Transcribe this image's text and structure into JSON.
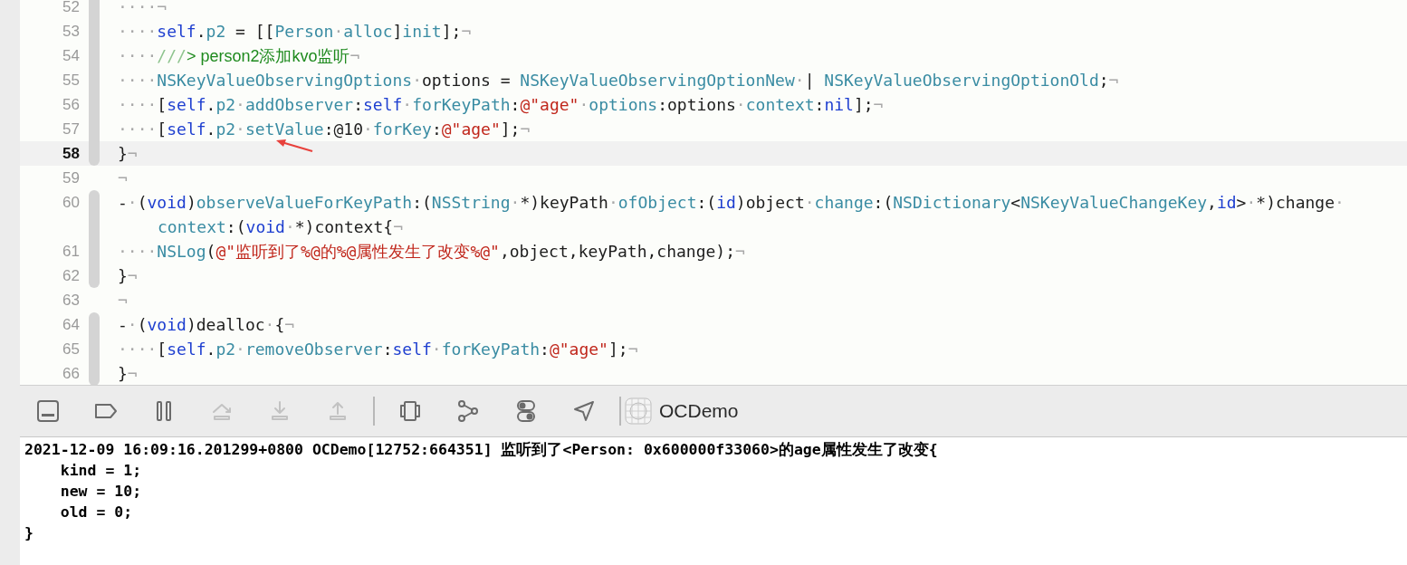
{
  "editor": {
    "lines": [
      {
        "number": "52",
        "current": false,
        "fold_bar": true,
        "tokens": [
          {
            "kind": "ws",
            "text": "····¬"
          }
        ]
      },
      {
        "number": "53",
        "current": false,
        "fold_bar": true,
        "tokens": [
          {
            "kind": "ws",
            "text": "····"
          },
          {
            "kind": "keyword",
            "text": "self"
          },
          {
            "kind": "plain",
            "text": "."
          },
          {
            "kind": "symbol",
            "text": "p2"
          },
          {
            "kind": "plain",
            "text": " = [["
          },
          {
            "kind": "symbol",
            "text": "Person"
          },
          {
            "kind": "ws",
            "text": "·"
          },
          {
            "kind": "symbol",
            "text": "alloc"
          },
          {
            "kind": "plain",
            "text": "]"
          },
          {
            "kind": "symbol",
            "text": "init"
          },
          {
            "kind": "plain",
            "text": "];"
          },
          {
            "kind": "ws",
            "text": "¬"
          }
        ]
      },
      {
        "number": "54",
        "current": false,
        "fold_bar": true,
        "tokens": [
          {
            "kind": "ws",
            "text": "····"
          },
          {
            "kind": "comment-mark",
            "text": "///"
          },
          {
            "kind": "comment",
            "text": "> person2添加kvo监听"
          },
          {
            "kind": "ws",
            "text": "¬"
          }
        ]
      },
      {
        "number": "55",
        "current": false,
        "fold_bar": true,
        "tokens": [
          {
            "kind": "ws",
            "text": "····"
          },
          {
            "kind": "symbol",
            "text": "NSKeyValueObservingOptions"
          },
          {
            "kind": "ws",
            "text": "·"
          },
          {
            "kind": "plain",
            "text": "options = "
          },
          {
            "kind": "symbol",
            "text": "NSKeyValueObservingOptionNew"
          },
          {
            "kind": "ws",
            "text": "·"
          },
          {
            "kind": "plain",
            "text": "| "
          },
          {
            "kind": "symbol",
            "text": "NSKeyValueObservingOptionOld"
          },
          {
            "kind": "plain",
            "text": ";"
          },
          {
            "kind": "ws",
            "text": "¬"
          }
        ]
      },
      {
        "number": "56",
        "current": false,
        "fold_bar": true,
        "tokens": [
          {
            "kind": "ws",
            "text": "····"
          },
          {
            "kind": "plain",
            "text": "["
          },
          {
            "kind": "keyword",
            "text": "self"
          },
          {
            "kind": "plain",
            "text": "."
          },
          {
            "kind": "symbol",
            "text": "p2"
          },
          {
            "kind": "ws",
            "text": "·"
          },
          {
            "kind": "symbol",
            "text": "addObserver"
          },
          {
            "kind": "plain",
            "text": ":"
          },
          {
            "kind": "keyword",
            "text": "self"
          },
          {
            "kind": "ws",
            "text": "·"
          },
          {
            "kind": "symbol",
            "text": "forKeyPath"
          },
          {
            "kind": "plain",
            "text": ":"
          },
          {
            "kind": "string",
            "text": "@\"age\""
          },
          {
            "kind": "ws",
            "text": "·"
          },
          {
            "kind": "symbol",
            "text": "options"
          },
          {
            "kind": "plain",
            "text": ":options"
          },
          {
            "kind": "ws",
            "text": "·"
          },
          {
            "kind": "symbol",
            "text": "context"
          },
          {
            "kind": "plain",
            "text": ":"
          },
          {
            "kind": "keyword",
            "text": "nil"
          },
          {
            "kind": "plain",
            "text": "];"
          },
          {
            "kind": "ws",
            "text": "¬"
          }
        ]
      },
      {
        "number": "57",
        "current": false,
        "fold_bar": true,
        "tokens": [
          {
            "kind": "ws",
            "text": "····"
          },
          {
            "kind": "plain",
            "text": "["
          },
          {
            "kind": "keyword",
            "text": "self"
          },
          {
            "kind": "plain",
            "text": "."
          },
          {
            "kind": "symbol",
            "text": "p2"
          },
          {
            "kind": "ws",
            "text": "·"
          },
          {
            "kind": "symbol",
            "text": "setValue"
          },
          {
            "kind": "plain",
            "text": ":@10"
          },
          {
            "kind": "ws",
            "text": "·"
          },
          {
            "kind": "symbol",
            "text": "forKey"
          },
          {
            "kind": "plain",
            "text": ":"
          },
          {
            "kind": "string",
            "text": "@\"age\""
          },
          {
            "kind": "plain",
            "text": "];"
          },
          {
            "kind": "ws",
            "text": "¬"
          }
        ]
      },
      {
        "number": "58",
        "current": true,
        "fold_bar": true,
        "tokens": [
          {
            "kind": "plain",
            "text": "}"
          },
          {
            "kind": "ws",
            "text": "¬"
          }
        ]
      },
      {
        "number": "59",
        "current": false,
        "fold_bar": false,
        "tokens": [
          {
            "kind": "ws",
            "text": "¬"
          }
        ]
      },
      {
        "number": "60",
        "current": false,
        "fold_bar": true,
        "tokens": [
          {
            "kind": "plain",
            "text": "-"
          },
          {
            "kind": "ws",
            "text": "·"
          },
          {
            "kind": "plain",
            "text": "("
          },
          {
            "kind": "keyword",
            "text": "void"
          },
          {
            "kind": "plain",
            "text": ")"
          },
          {
            "kind": "symbol",
            "text": "observeValueForKeyPath"
          },
          {
            "kind": "plain",
            "text": ":("
          },
          {
            "kind": "symbol",
            "text": "NSString"
          },
          {
            "kind": "ws",
            "text": "·"
          },
          {
            "kind": "plain",
            "text": "*)keyPath"
          },
          {
            "kind": "ws",
            "text": "·"
          },
          {
            "kind": "symbol",
            "text": "ofObject"
          },
          {
            "kind": "plain",
            "text": ":("
          },
          {
            "kind": "keyword",
            "text": "id"
          },
          {
            "kind": "plain",
            "text": ")object"
          },
          {
            "kind": "ws",
            "text": "·"
          },
          {
            "kind": "symbol",
            "text": "change"
          },
          {
            "kind": "plain",
            "text": ":("
          },
          {
            "kind": "symbol",
            "text": "NSDictionary"
          },
          {
            "kind": "plain",
            "text": "<"
          },
          {
            "kind": "symbol",
            "text": "NSKeyValueChangeKey"
          },
          {
            "kind": "plain",
            "text": ","
          },
          {
            "kind": "keyword",
            "text": "id"
          },
          {
            "kind": "plain",
            "text": ">"
          },
          {
            "kind": "ws",
            "text": "·"
          },
          {
            "kind": "plain",
            "text": "*)change"
          },
          {
            "kind": "ws",
            "text": "·"
          }
        ],
        "wrapped_tokens": [
          {
            "kind": "symbol",
            "text": "context"
          },
          {
            "kind": "plain",
            "text": ":("
          },
          {
            "kind": "keyword",
            "text": "void"
          },
          {
            "kind": "ws",
            "text": "·"
          },
          {
            "kind": "plain",
            "text": "*)context{"
          },
          {
            "kind": "ws",
            "text": "¬"
          }
        ]
      },
      {
        "number": "61",
        "current": false,
        "fold_bar": true,
        "tokens": [
          {
            "kind": "ws",
            "text": "····"
          },
          {
            "kind": "symbol",
            "text": "NSLog"
          },
          {
            "kind": "plain",
            "text": "("
          },
          {
            "kind": "string",
            "text": "@\"监听到了%@的%@属性发生了改变%@\""
          },
          {
            "kind": "plain",
            "text": ",object,keyPath,change);"
          },
          {
            "kind": "ws",
            "text": "¬"
          }
        ]
      },
      {
        "number": "62",
        "current": false,
        "fold_bar": true,
        "tokens": [
          {
            "kind": "plain",
            "text": "}"
          },
          {
            "kind": "ws",
            "text": "¬"
          }
        ]
      },
      {
        "number": "63",
        "current": false,
        "fold_bar": false,
        "tokens": [
          {
            "kind": "ws",
            "text": "¬"
          }
        ]
      },
      {
        "number": "64",
        "current": false,
        "fold_bar": true,
        "tokens": [
          {
            "kind": "plain",
            "text": "-"
          },
          {
            "kind": "ws",
            "text": "·"
          },
          {
            "kind": "plain",
            "text": "("
          },
          {
            "kind": "keyword",
            "text": "void"
          },
          {
            "kind": "plain",
            "text": ")dealloc"
          },
          {
            "kind": "ws",
            "text": "·"
          },
          {
            "kind": "plain",
            "text": "{"
          },
          {
            "kind": "ws",
            "text": "¬"
          }
        ]
      },
      {
        "number": "65",
        "current": false,
        "fold_bar": true,
        "tokens": [
          {
            "kind": "ws",
            "text": "····"
          },
          {
            "kind": "plain",
            "text": "["
          },
          {
            "kind": "keyword",
            "text": "self"
          },
          {
            "kind": "plain",
            "text": "."
          },
          {
            "kind": "symbol",
            "text": "p2"
          },
          {
            "kind": "ws",
            "text": "·"
          },
          {
            "kind": "symbol",
            "text": "removeObserver"
          },
          {
            "kind": "plain",
            "text": ":"
          },
          {
            "kind": "keyword",
            "text": "self"
          },
          {
            "kind": "ws",
            "text": "·"
          },
          {
            "kind": "symbol",
            "text": "forKeyPath"
          },
          {
            "kind": "plain",
            "text": ":"
          },
          {
            "kind": "string",
            "text": "@\"age\""
          },
          {
            "kind": "plain",
            "text": "];"
          },
          {
            "kind": "ws",
            "text": "¬"
          }
        ]
      },
      {
        "number": "66",
        "current": false,
        "fold_bar": true,
        "tokens": [
          {
            "kind": "plain",
            "text": "}"
          },
          {
            "kind": "ws",
            "text": "¬"
          }
        ]
      }
    ]
  },
  "debug_bar": {
    "items": [
      {
        "kind": "console",
        "disabled": false
      },
      {
        "kind": "breakpoint",
        "disabled": false
      },
      {
        "kind": "pause",
        "disabled": false
      },
      {
        "kind": "step-over",
        "disabled": true
      },
      {
        "kind": "step-into",
        "disabled": true
      },
      {
        "kind": "step-out",
        "disabled": true
      },
      {
        "kind": "separator"
      },
      {
        "kind": "view-debug",
        "disabled": false
      },
      {
        "kind": "memory-graph",
        "disabled": false
      },
      {
        "kind": "environment",
        "disabled": false
      },
      {
        "kind": "location",
        "disabled": false
      },
      {
        "kind": "separator"
      }
    ],
    "target": "OCDemo"
  },
  "console": {
    "lines": [
      "2021-12-09 16:09:16.201299+0800 OCDemo[12752:664351] 监听到了<Person: 0x600000f33060>的age属性发生了改变{",
      "    kind = 1;",
      "    new = 10;",
      "    old = 0;",
      "}"
    ]
  }
}
